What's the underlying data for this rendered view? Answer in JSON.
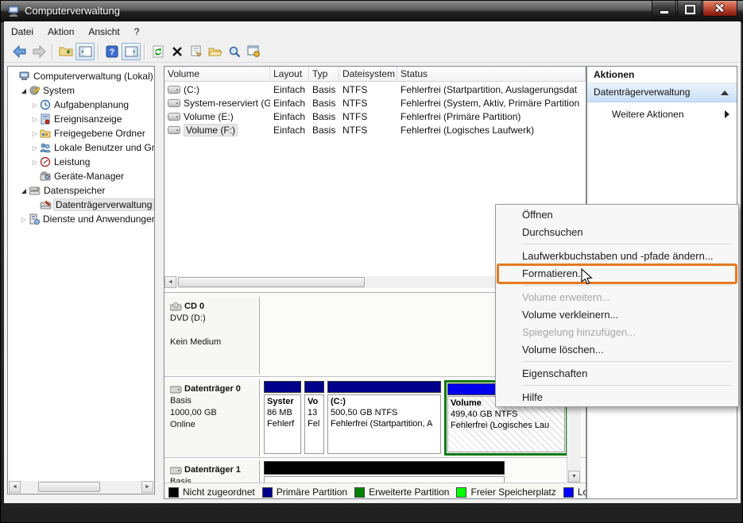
{
  "window": {
    "title": "Computerverwaltung"
  },
  "menubar": {
    "items": [
      "Datei",
      "Aktion",
      "Ansicht",
      "?"
    ]
  },
  "toolbar": {
    "icons": [
      "back-icon",
      "forward-icon",
      "folder-up-icon",
      "console-tree-icon",
      "help-icon",
      "action-pane-icon",
      "refresh-icon",
      "delete-icon",
      "properties-icon",
      "open-folder-icon",
      "search-icon",
      "export-list-icon"
    ]
  },
  "tree": {
    "items": [
      {
        "label": "Computerverwaltung (Lokal)",
        "icon": "computer-icon",
        "expander": "none",
        "level": 0
      },
      {
        "label": "System",
        "icon": "system-icon",
        "expander": "expanded",
        "level": 1
      },
      {
        "label": "Aufgabenplanung",
        "icon": "task-scheduler-icon",
        "expander": "collapsed",
        "level": 2
      },
      {
        "label": "Ereignisanzeige",
        "icon": "event-viewer-icon",
        "expander": "collapsed",
        "level": 2
      },
      {
        "label": "Freigegebene Ordner",
        "icon": "shared-folders-icon",
        "expander": "collapsed",
        "level": 2
      },
      {
        "label": "Lokale Benutzer und Gru",
        "icon": "local-users-icon",
        "expander": "collapsed",
        "level": 2
      },
      {
        "label": "Leistung",
        "icon": "performance-icon",
        "expander": "collapsed",
        "level": 2
      },
      {
        "label": "Geräte-Manager",
        "icon": "device-manager-icon",
        "expander": "none",
        "level": 2
      },
      {
        "label": "Datenspeicher",
        "icon": "storage-icon",
        "expander": "expanded",
        "level": 1
      },
      {
        "label": "Datenträgerverwaltung",
        "icon": "disk-management-icon",
        "expander": "none",
        "level": 2,
        "selected": true
      },
      {
        "label": "Dienste und Anwendungen",
        "icon": "services-icon",
        "expander": "collapsed",
        "level": 1
      }
    ]
  },
  "volume_list": {
    "columns": [
      "Volume",
      "Layout",
      "Typ",
      "Dateisystem",
      "Status"
    ],
    "rows": [
      {
        "volume": "(C:)",
        "layout": "Einfach",
        "typ": "Basis",
        "dateisystem": "NTFS",
        "status": "Fehlerfrei (Startpartition, Auslagerungsdat"
      },
      {
        "volume": "System-reserviert (G:)",
        "layout": "Einfach",
        "typ": "Basis",
        "dateisystem": "NTFS",
        "status": "Fehlerfrei (System, Aktiv, Primäre Partition"
      },
      {
        "volume": "Volume (E:)",
        "layout": "Einfach",
        "typ": "Basis",
        "dateisystem": "NTFS",
        "status": "Fehlerfrei (Primäre Partition)"
      },
      {
        "volume": "Volume (F:)",
        "layout": "Einfach",
        "typ": "Basis",
        "dateisystem": "NTFS",
        "status": "Fehlerfrei (Logisches Laufwerk)",
        "selected": true
      }
    ]
  },
  "actions_panel": {
    "header": "Aktionen",
    "group": "Datenträgerverwaltung",
    "more": "Weitere Aktionen"
  },
  "disk_view": {
    "cd0": {
      "title": "CD 0",
      "type_line": "DVD (D:)",
      "status_line": "Kein Medium"
    },
    "disk0": {
      "title": "Datenträger 0",
      "lines": [
        "Basis",
        "1000,00 GB",
        "Online"
      ],
      "partitions": [
        {
          "name": "Syster",
          "size": "86 MB",
          "status": "Fehlerf",
          "band": "#00008B"
        },
        {
          "name": "Vo",
          "size": "13",
          "status": "Fel",
          "band": "#00008B"
        },
        {
          "name": "(C:)",
          "size": "500,50 GB NTFS",
          "status": "Fehlerfrei (Startpartition, A",
          "band": "#00008B"
        },
        {
          "name": "Volume",
          "size": "499,40 GB NTFS",
          "status": "Fehlerfrei (Logisches Lau",
          "band": "#0000EE",
          "selected": true
        }
      ]
    },
    "disk1": {
      "title": "Datenträger 1",
      "lines": [
        "Basis"
      ],
      "band": "#000000"
    }
  },
  "legend": {
    "items": [
      {
        "label": "Nicht zugeordnet",
        "color": "#000000"
      },
      {
        "label": "Primäre Partition",
        "color": "#00008B"
      },
      {
        "label": "Erweiterte Partition",
        "color": "#008000"
      },
      {
        "label": "Freier Speicherplatz",
        "color": "#00FF00"
      },
      {
        "label": "Logisch",
        "color": "#0000FF"
      }
    ]
  },
  "context_menu": {
    "items": [
      {
        "label": "Öffnen"
      },
      {
        "label": "Durchsuchen"
      },
      {
        "separator": true
      },
      {
        "label": "Laufwerkbuchstaben und -pfade ändern..."
      },
      {
        "label": "Formatieren...",
        "highlighted": true
      },
      {
        "separator": true
      },
      {
        "label": "Volume erweitern...",
        "disabled": true
      },
      {
        "label": "Volume verkleinern..."
      },
      {
        "label": "Spiegelung hinzufügen...",
        "disabled": true
      },
      {
        "label": "Volume löschen..."
      },
      {
        "separator": true
      },
      {
        "label": "Eigenschaften"
      },
      {
        "separator": true
      },
      {
        "label": "Hilfe"
      }
    ]
  },
  "colors": {
    "accent_orange": "#E8791E",
    "primary_partition": "#00008B",
    "logical_drive": "#0000EE",
    "extended_partition_border": "#0C7A0C",
    "free_space": "#00FF00",
    "unallocated": "#000000",
    "action_group_gradient": "#C9DFF6"
  }
}
